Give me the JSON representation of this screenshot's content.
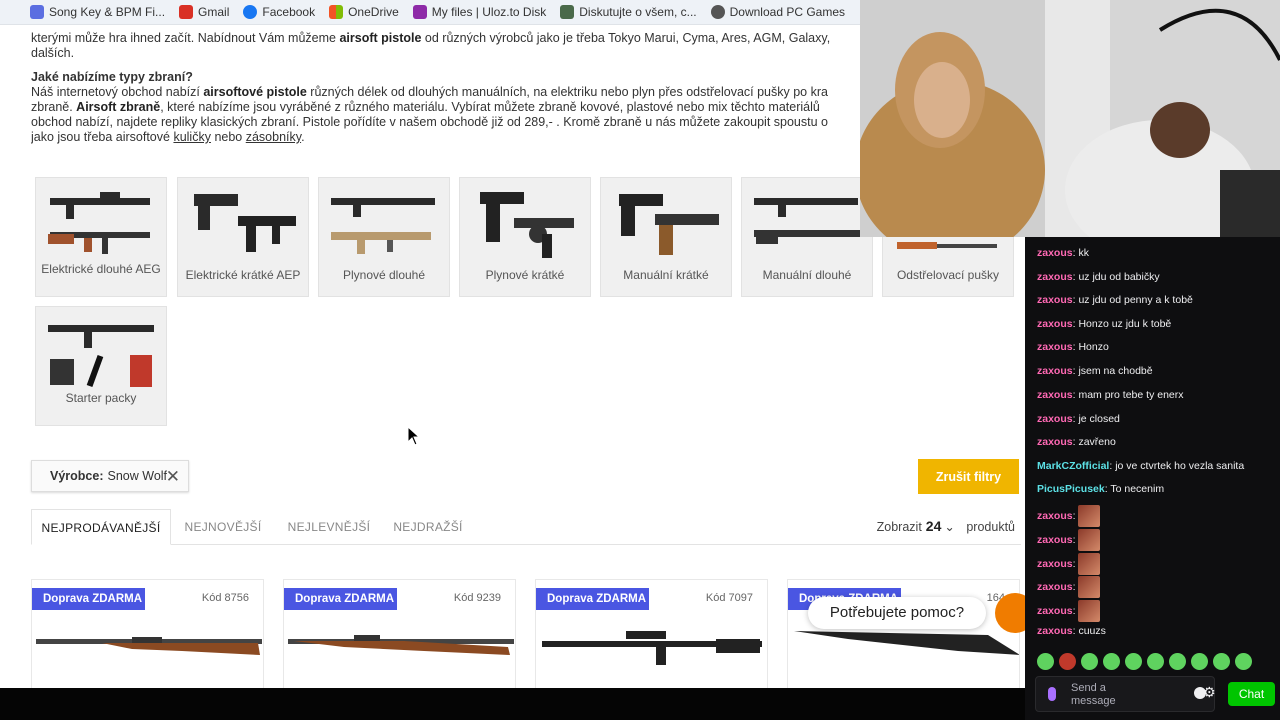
{
  "bookmarks": [
    {
      "label": "Song Key & BPM Fi...",
      "icon": "music-note-icon",
      "color": "#5b6ee1"
    },
    {
      "label": "Gmail",
      "icon": "gmail-icon",
      "color": "#d93025"
    },
    {
      "label": "Facebook",
      "icon": "facebook-icon",
      "color": "#1877f2"
    },
    {
      "label": "OneDrive",
      "icon": "windows-icon",
      "color": "#f35325"
    },
    {
      "label": "My files | Uloz.to Disk",
      "icon": "uloz-icon",
      "color": "#8e2aa8"
    },
    {
      "label": "Diskutujte o všem, c...",
      "icon": "sword-icon",
      "color": "#4a6a4a"
    },
    {
      "label": "Download PC Games",
      "icon": "globe-icon",
      "color": "#555555"
    }
  ],
  "intro": {
    "line1_pre": "kterými může hra ihned začít. Nabídnout Vám můžeme ",
    "line1_bold": "airsoft pistole",
    "line1_post": " od různých výrobců jako je třeba Tokyo Marui, Cyma, Ares, AGM, Galaxy,",
    "line2": "dalších.",
    "question": "Jaké nabízíme typy zbraní?",
    "line3_pre": "Náš internetový obchod nabízí ",
    "line3_bold": "airsoftové pistole",
    "line3_post": " různých délek od dlouhých manuálních, na elektriku nebo plyn přes odstřelovací pušky po kra",
    "line4_pre": "zbraně. ",
    "line4_bold": "Airsoft zbraně",
    "line4_post": ", které nabízíme jsou vyráběné z různého materiálu. Vybírat můžete zbraně kovové, plastové nebo mix těchto materiálů",
    "line5": "obchod nabízí, najdete repliky klasických zbraní. Pistole pořídíte v našem obchodě již od 289,- . Kromě zbraně u nás můžete zakoupit spoustu o",
    "line6_pre": "jako jsou třeba airsoftové ",
    "line6_link1": "kuličky",
    "line6_mid": " nebo ",
    "line6_link2": "zásobníky",
    "line6_post": "."
  },
  "categories": [
    {
      "label": "Elektrické dlouhé AEG"
    },
    {
      "label": "Elektrické krátké AEP"
    },
    {
      "label": "Plynové dlouhé"
    },
    {
      "label": "Plynové krátké"
    },
    {
      "label": "Manuální krátké"
    },
    {
      "label": "Manuální dlouhé"
    },
    {
      "label": "Odstřelovací pušky"
    },
    {
      "label": "Starter packy"
    }
  ],
  "filter": {
    "key": "Výrobce:",
    "value": "Snow Wolf",
    "remove": "✕"
  },
  "clear_filters": "Zrušit filtry",
  "sort_tabs": [
    "NEJPRODÁVANĚJŠÍ",
    "NEJNOVĚJŠÍ",
    "NEJLEVNĚJŠÍ",
    "NEJDRAŽŠÍ"
  ],
  "per_page": {
    "prefix": "Zobrazit",
    "value": "24",
    "chevron": "⌄",
    "suffix": "produktů"
  },
  "products": [
    {
      "badge": "Doprava ZDARMA",
      "code": "Kód 8756"
    },
    {
      "badge": "Doprava ZDARMA",
      "code": "Kód 9239"
    },
    {
      "badge": "Doprava ZDARMA",
      "code": "Kód 7097"
    },
    {
      "badge": "Doprava ZDARMA",
      "code": "164"
    }
  ],
  "help": "Potřebujete pomoc?",
  "chat": {
    "messages": [
      {
        "user": "zaxous",
        "text": "kk",
        "color": "#ff69b4"
      },
      {
        "user": "zaxous",
        "text": "uz jdu od babičky",
        "color": "#ff69b4"
      },
      {
        "user": "zaxous",
        "text": "uz jdu od penny a k tobě",
        "color": "#ff69b4"
      },
      {
        "user": "zaxous",
        "text": "Honzo uz jdu k tobě",
        "color": "#ff69b4"
      },
      {
        "user": "zaxous",
        "text": "Honzo",
        "color": "#ff69b4"
      },
      {
        "user": "zaxous",
        "text": "jsem na chodbě",
        "color": "#ff69b4"
      },
      {
        "user": "zaxous",
        "text": "mam pro tebe ty enerx",
        "color": "#ff69b4"
      },
      {
        "user": "zaxous",
        "text": "je closed",
        "color": "#ff69b4"
      },
      {
        "user": "zaxous",
        "text": "zavřeno",
        "color": "#ff69b4"
      },
      {
        "user": "MarkCZofficial",
        "text": "jo ve ctvrtek ho vezla sanita",
        "color": "#5ce1e6"
      },
      {
        "user": "PicusPicusek",
        "text": "To necenim",
        "color": "#5ce1e6"
      },
      {
        "user": "zaxous",
        "text": "",
        "color": "#ff69b4"
      },
      {
        "user": "zaxous",
        "text": "",
        "color": "#ff69b4"
      },
      {
        "user": "zaxous",
        "text": "",
        "color": "#ff69b4"
      },
      {
        "user": "zaxous",
        "text": "",
        "color": "#ff69b4"
      },
      {
        "user": "zaxous",
        "text": "",
        "color": "#ff69b4"
      },
      {
        "user": "zaxous",
        "text": "cuuzs",
        "color": "#ff69b4"
      }
    ],
    "separator": ": ",
    "input_placeholder": "Send a message",
    "send_label": "Chat"
  }
}
